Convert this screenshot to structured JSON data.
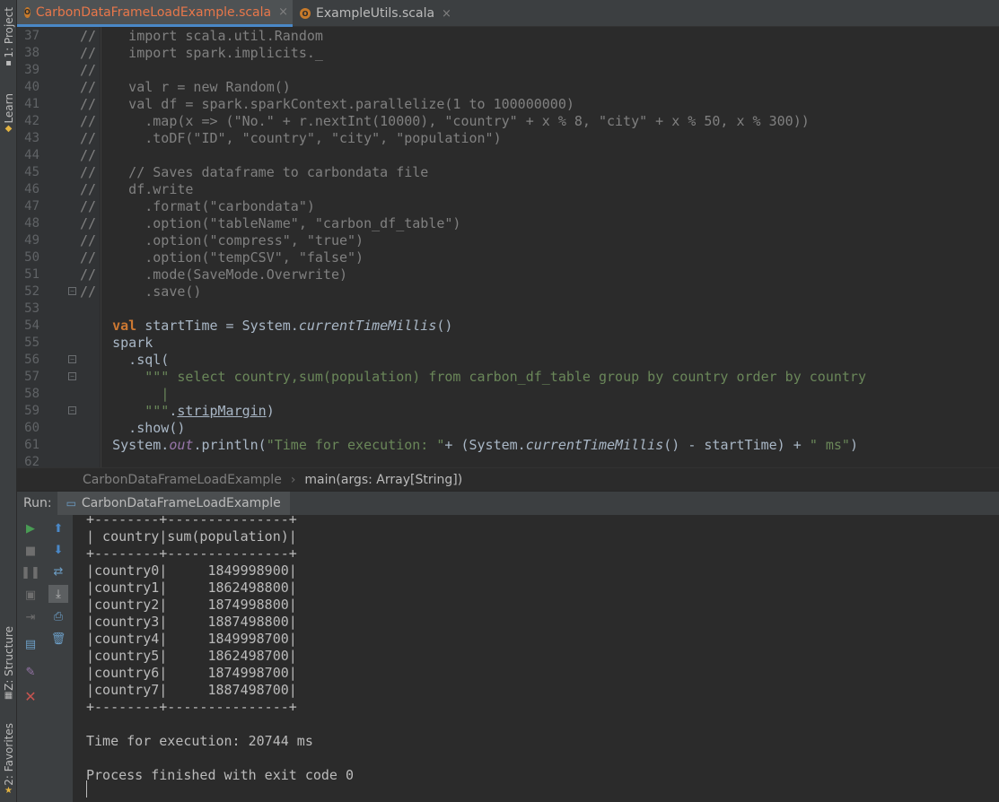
{
  "side_tabs": {
    "project": "1: Project",
    "learn": "Learn",
    "structure": "Z: Structure",
    "favorites": "2: Favorites"
  },
  "editor_tabs": [
    {
      "label": "CarbonDataFrameLoadExample.scala",
      "active": true
    },
    {
      "label": "ExampleUtils.scala",
      "active": false
    }
  ],
  "editor": {
    "lines": [
      {
        "n": "37",
        "text": "//    import scala.util.Random"
      },
      {
        "n": "38",
        "text": "//    import spark.implicits._"
      },
      {
        "n": "39",
        "text": "//"
      },
      {
        "n": "40",
        "text": "//    val r = new Random()"
      },
      {
        "n": "41",
        "text": "//    val df = spark.sparkContext.parallelize(1 to 100000000)"
      },
      {
        "n": "42",
        "text": "//      .map(x => (\"No.\" + r.nextInt(10000), \"country\" + x % 8, \"city\" + x % 50, x % 300))"
      },
      {
        "n": "43",
        "text": "//      .toDF(\"ID\", \"country\", \"city\", \"population\")"
      },
      {
        "n": "44",
        "text": "//"
      },
      {
        "n": "45",
        "text": "//    // Saves dataframe to carbondata file"
      },
      {
        "n": "46",
        "text": "//    df.write"
      },
      {
        "n": "47",
        "text": "//      .format(\"carbondata\")"
      },
      {
        "n": "48",
        "text": "//      .option(\"tableName\", \"carbon_df_table\")"
      },
      {
        "n": "49",
        "text": "//      .option(\"compress\", \"true\")"
      },
      {
        "n": "50",
        "text": "//      .option(\"tempCSV\", \"false\")"
      },
      {
        "n": "51",
        "text": "//      .mode(SaveMode.Overwrite)"
      },
      {
        "n": "52",
        "text": "//      .save()"
      },
      {
        "n": "53",
        "text": ""
      },
      {
        "n": "54",
        "text": ""
      },
      {
        "n": "55",
        "text": "    spark"
      },
      {
        "n": "56",
        "text": "      .sql("
      },
      {
        "n": "57",
        "text": ""
      },
      {
        "n": "58",
        "text": "          |"
      },
      {
        "n": "59",
        "text": ""
      },
      {
        "n": "60",
        "text": "      .show()"
      },
      {
        "n": "61",
        "text": ""
      },
      {
        "n": "62",
        "text": ""
      }
    ],
    "line54": {
      "kw": "val",
      "a": " startTime = System.",
      "fn": "currentTimeMillis",
      "b": "()"
    },
    "line57": {
      "q": "\"\"\"",
      "sql": " select country,sum(population) from carbon_df_table group by country order by country"
    },
    "line59": {
      "q": "\"\"\"",
      "dot": ".",
      "fn": "stripMargin",
      "rest": ")"
    },
    "line61": {
      "a": "    System.",
      "out": "out",
      "b": ".println(",
      "s1": "\"Time for execution: \"",
      "c": "+ (System.",
      "fn": "currentTimeMillis",
      "d": "() - startTime) + ",
      "s2": "\" ms\"",
      "e": ")"
    }
  },
  "breadcrumb": {
    "item1": "CarbonDataFrameLoadExample",
    "item2": "main(args: Array[String])"
  },
  "run": {
    "label": "Run:",
    "config": "CarbonDataFrameLoadExample"
  },
  "console": {
    "lines": [
      "+--------+---------------+",
      "| country|sum(population)|",
      "+--------+---------------+",
      "|country0|     1849998900|",
      "|country1|     1862498800|",
      "|country2|     1874998800|",
      "|country3|     1887498800|",
      "|country4|     1849998700|",
      "|country5|     1862498700|",
      "|country6|     1874998700|",
      "|country7|     1887498700|",
      "+--------+---------------+",
      "",
      "Time for execution: 20744 ms",
      "",
      "Process finished with exit code 0"
    ]
  },
  "toolbar_icons": {
    "col1": [
      "run-icon",
      "stop-icon",
      "pause-icon",
      "dump-icon",
      "exit-icon",
      "layout-icon",
      "pin-icon",
      "close-icon"
    ],
    "col2": [
      "up-arrow-icon",
      "down-arrow-icon",
      "soft-wrap-icon",
      "scroll-end-icon",
      "print-icon",
      "trash-icon"
    ]
  },
  "colors": {
    "background": "#2b2b2b",
    "keyword": "#cc7832",
    "string": "#6a8759",
    "comment": "#808080",
    "field": "#9876aa",
    "active_tab": "#e8774a"
  }
}
